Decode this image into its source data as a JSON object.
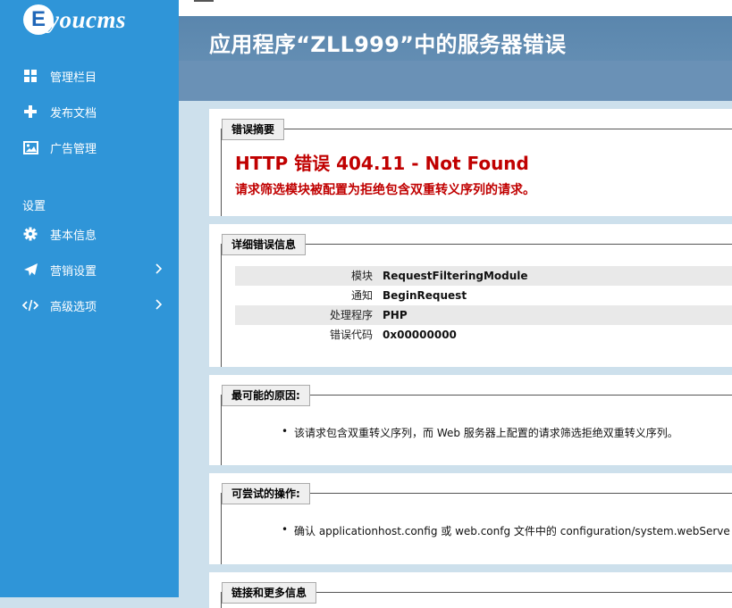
{
  "sidebar": {
    "logo_text": "youcms",
    "logo_letter": "E",
    "nav": [
      {
        "label": "管理栏目",
        "icon": "grid-icon"
      },
      {
        "label": "发布文档",
        "icon": "plus-icon"
      },
      {
        "label": "广告管理",
        "icon": "image-icon"
      }
    ],
    "section_label": "设置",
    "settings": [
      {
        "label": "基本信息",
        "icon": "gear-icon"
      },
      {
        "label": "营销设置",
        "icon": "paper-plane-icon"
      },
      {
        "label": "高级选项",
        "icon": "code-icon"
      }
    ]
  },
  "header": {
    "title": "应用程序“ZLL999”中的服务器错误"
  },
  "summary": {
    "legend": "错误摘要",
    "title": "HTTP 错误 404.11 - Not Found",
    "message": "请求筛选模块被配置为拒绝包含双重转义序列的请求。"
  },
  "details": {
    "legend": "详细错误信息",
    "rows": [
      {
        "key": "模块",
        "value": "RequestFilteringModule"
      },
      {
        "key": "通知",
        "value": "BeginRequest"
      },
      {
        "key": "处理程序",
        "value": "PHP"
      },
      {
        "key": "错误代码",
        "value": "0x00000000"
      }
    ]
  },
  "causes": {
    "legend": "最可能的原因:",
    "items": [
      "该请求包含双重转义序列，而 Web 服务器上配置的请求筛选拒绝双重转义序列。"
    ]
  },
  "actions": {
    "legend": "可尝试的操作:",
    "items": [
      "确认 applicationhost.config 或 web.confg 文件中的 configuration/system.webServe"
    ]
  },
  "links": {
    "legend": "链接和更多信息"
  },
  "colors": {
    "sidebar": "#2f95d8",
    "header": "#5a86ad",
    "error": "#c00000",
    "background": "#cde0ec"
  }
}
